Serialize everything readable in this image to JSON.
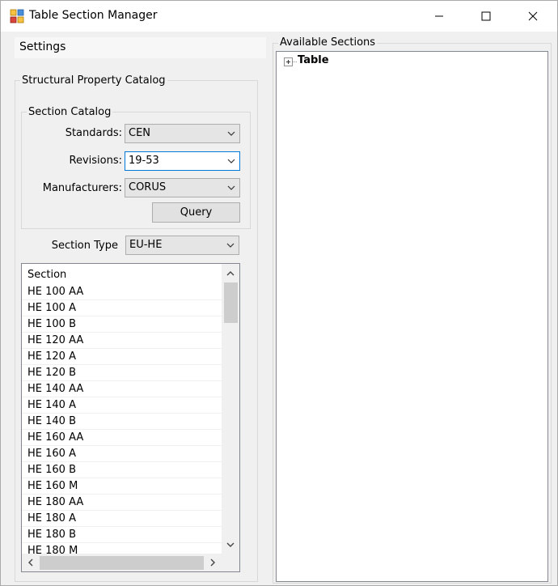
{
  "window": {
    "title": "Table Section Manager"
  },
  "settings": {
    "header": "Settings",
    "catalog_group": "Structural Property Catalog",
    "section_catalog_group": "Section Catalog",
    "standards_label": "Standards:",
    "standards_value": "CEN",
    "revisions_label": "Revisions:",
    "revisions_value": "19-53",
    "manufacturers_label": "Manufacturers:",
    "manufacturers_value": "CORUS",
    "query_label": "Query",
    "section_type_label": "Section Type",
    "section_type_value": "EU-HE"
  },
  "section_list": {
    "header": "Section",
    "items": [
      "HE 100 AA",
      "HE 100 A",
      "HE 100 B",
      "HE 120 AA",
      "HE 120 A",
      "HE 120 B",
      "HE 140 AA",
      "HE 140 A",
      "HE 140 B",
      "HE 160 AA",
      "HE 160 A",
      "HE 160 B",
      "HE 160 M",
      "HE 180 AA",
      "HE 180 A",
      "HE 180 B",
      "HE 180 M"
    ]
  },
  "available_sections": {
    "group_label": "Available Sections",
    "tree_root": "Table"
  }
}
